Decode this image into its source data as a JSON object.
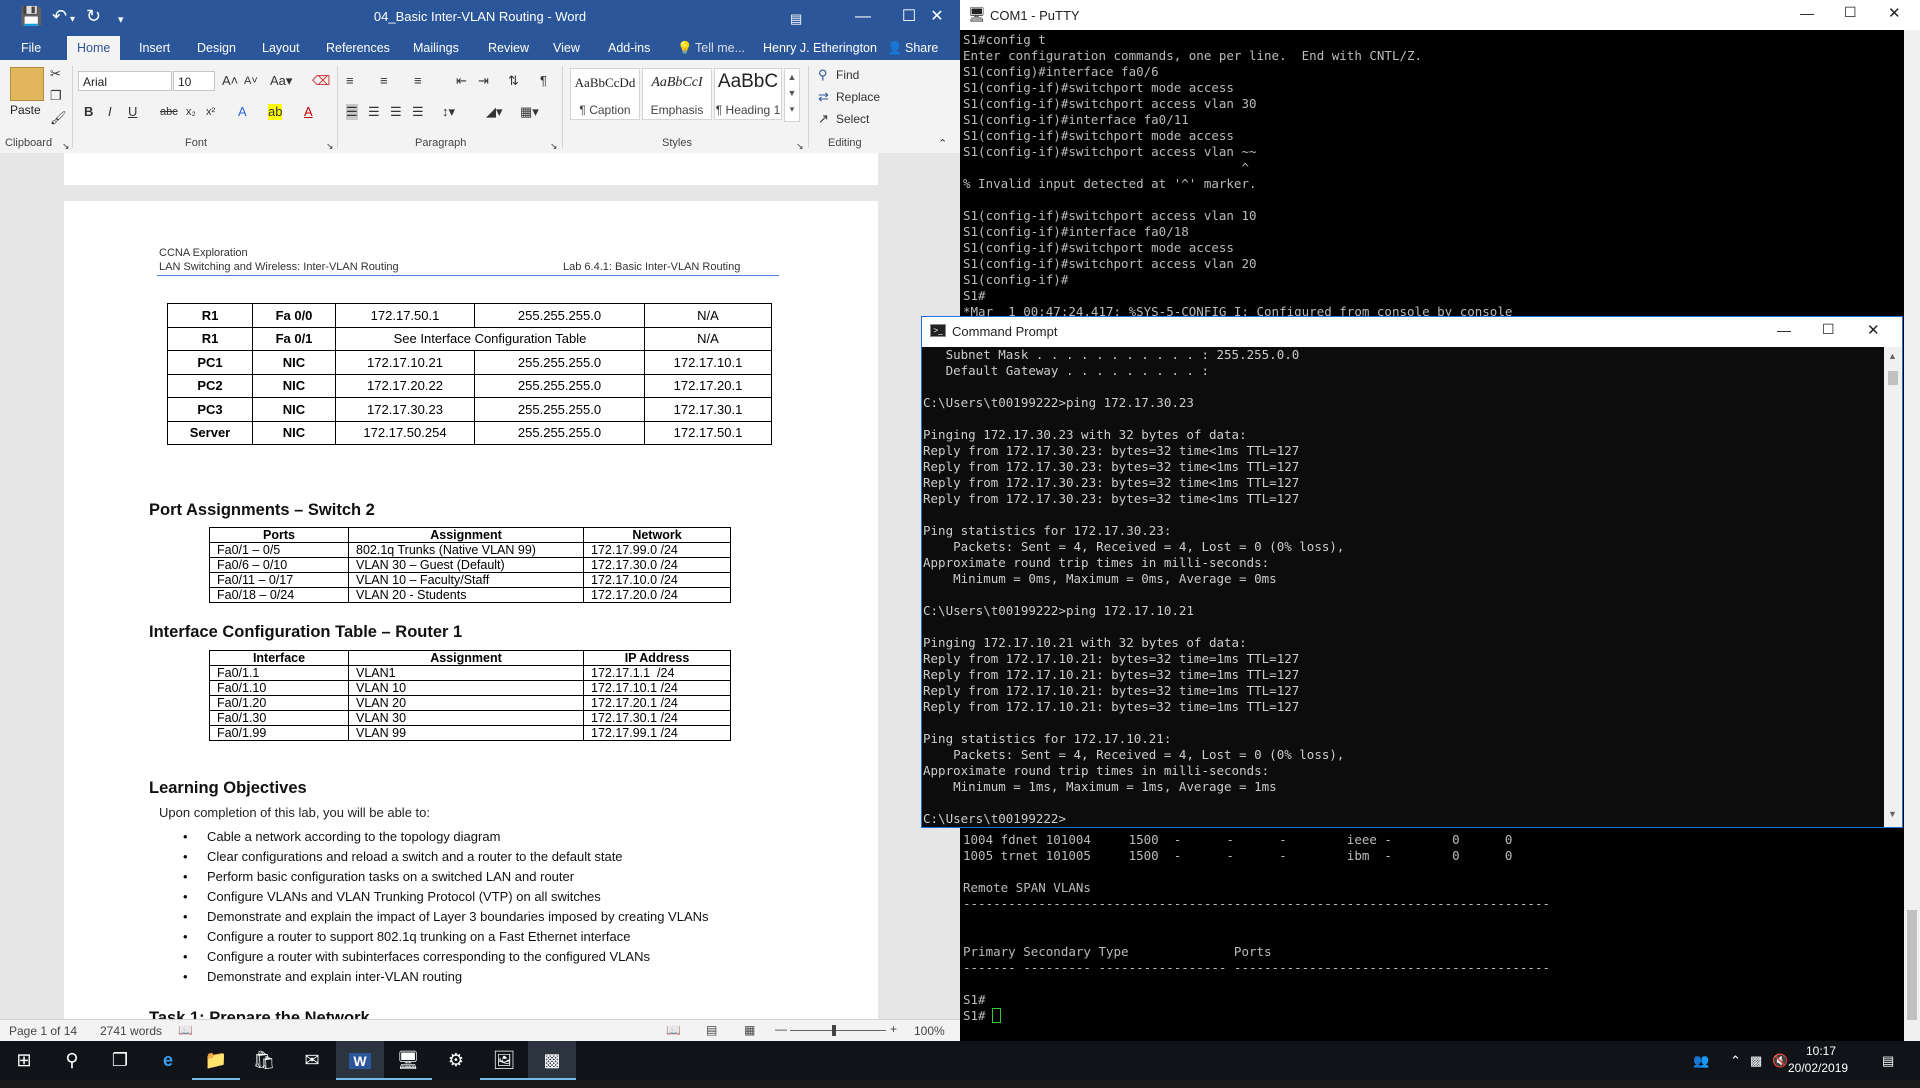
{
  "word": {
    "title": "04_Basic Inter-VLAN Routing - Word",
    "qat": {
      "save_icon": "save-icon",
      "undo_icon": "undo-icon",
      "redo_icon": "redo-icon"
    },
    "tabs": [
      "File",
      "Home",
      "Insert",
      "Design",
      "Layout",
      "References",
      "Mailings",
      "Review",
      "View",
      "Add-ins"
    ],
    "active_tab": "Home",
    "tell_me": "Tell me...",
    "user": "Henry J. Etherington",
    "share": "Share",
    "ribbon": {
      "paste": "Paste",
      "clipboard": "Clipboard",
      "font_name": "Arial",
      "font_size": "10",
      "font": "Font",
      "paragraph": "Paragraph",
      "styles": "Styles",
      "editing": "Editing",
      "style_gallery": [
        {
          "sample": "AaBbCcDd",
          "name": "¶ Caption"
        },
        {
          "sample": "AaBbCcI",
          "name": "Emphasis"
        },
        {
          "sample": "AaBbC",
          "name": "¶ Heading 1"
        }
      ],
      "find": "Find",
      "replace": "Replace",
      "select": "Select"
    },
    "doc": {
      "header_line1": "CCNA Exploration",
      "header_line2": "LAN Switching and Wireless: Inter-VLAN Routing",
      "header_right": "Lab 6.4.1: Basic Inter-VLAN Routing",
      "addr_table": [
        [
          "R1",
          "Fa 0/0",
          "172.17.50.1",
          "255.255.255.0",
          "N/A"
        ],
        [
          "R1",
          "Fa 0/1",
          "See Interface Configuration Table",
          "",
          "N/A"
        ],
        [
          "PC1",
          "NIC",
          "172.17.10.21",
          "255.255.255.0",
          "172.17.10.1"
        ],
        [
          "PC2",
          "NIC",
          "172.17.20.22",
          "255.255.255.0",
          "172.17.20.1"
        ],
        [
          "PC3",
          "NIC",
          "172.17.30.23",
          "255.255.255.0",
          "172.17.30.1"
        ],
        [
          "Server",
          "NIC",
          "172.17.50.254",
          "255.255.255.0",
          "172.17.50.1"
        ]
      ],
      "port_heading": "Port Assignments – Switch 2",
      "port_cols": [
        "Ports",
        "Assignment",
        "Network"
      ],
      "port_rows": [
        [
          "Fa0/1 – 0/5",
          "802.1q Trunks (Native VLAN 99)",
          "172.17.99.0 /24"
        ],
        [
          "Fa0/6 – 0/10",
          "VLAN 30 – Guest (Default)",
          "172.17.30.0 /24"
        ],
        [
          "Fa0/11 – 0/17",
          "VLAN 10 – Faculty/Staff",
          "172.17.10.0 /24"
        ],
        [
          "Fa0/18 – 0/24",
          "VLAN 20 - Students",
          "172.17.20.0 /24"
        ]
      ],
      "iface_heading": "Interface Configuration Table – Router 1",
      "iface_cols": [
        "Interface",
        "Assignment",
        "IP Address"
      ],
      "iface_rows": [
        [
          "Fa0/1.1",
          "VLAN1",
          "172.17.1.1  /24"
        ],
        [
          "Fa0/1.10",
          "VLAN 10",
          "172.17.10.1 /24"
        ],
        [
          "Fa0/1.20",
          "VLAN 20",
          "172.17.20.1 /24"
        ],
        [
          "Fa0/1.30",
          "VLAN 30",
          "172.17.30.1 /24"
        ],
        [
          "Fa0/1.99",
          "VLAN 99",
          "172.17.99.1 /24"
        ]
      ],
      "objectives_heading": "Learning Objectives",
      "objectives_intro": "Upon completion of this lab, you will be able to:",
      "objectives": [
        "Cable a network according to the topology diagram",
        "Clear configurations and reload a switch and a router to the default state",
        "Perform basic configuration tasks on a switched LAN and router",
        "Configure VLANs and VLAN Trunking Protocol (VTP) on all switches",
        "Demonstrate and explain the impact of Layer 3 boundaries imposed by creating VLANs",
        "Configure a router to support 802.1q trunking on a Fast Ethernet interface",
        "Configure a router with subinterfaces corresponding to the configured VLANs",
        "Demonstrate and explain inter-VLAN routing"
      ],
      "next_heading": "Task 1: Prepare the Network"
    },
    "status": {
      "page": "Page 1 of 14",
      "words": "2741 words",
      "zoom": "100%"
    }
  },
  "putty": {
    "title": "COM1 - PuTTY",
    "top_lines": [
      "S1#config t",
      "Enter configuration commands, one per line.  End with CNTL/Z.",
      "S1(config)#interface fa0/6",
      "S1(config-if)#switchport mode access",
      "S1(config-if)#switchport access vlan 30",
      "S1(config-if)#interface fa0/11",
      "S1(config-if)#switchport mode access",
      "S1(config-if)#switchport access vlan ~~",
      "                                     ^",
      "% Invalid input detected at '^' marker.",
      "",
      "S1(config-if)#switchport access vlan 10",
      "S1(config-if)#interface fa0/18",
      "S1(config-if)#switchport mode access",
      "S1(config-if)#switchport access vlan 20",
      "S1(config-if)#",
      "S1#",
      "*Mar  1 00:47:24.417: %SYS-5-CONFIG_I: Configured from console by console"
    ],
    "bottom_lines": [
      "1004 fdnet 101004     1500  -      -      -        ieee -        0      0",
      "1005 trnet 101005     1500  -      -      -        ibm  -        0      0",
      "",
      "Remote SPAN VLANs",
      "------------------------------------------------------------------------------",
      "",
      "",
      "Primary Secondary Type              Ports",
      "------- --------- ----------------- ------------------------------------------",
      "",
      "S1#",
      "S1#"
    ]
  },
  "cmd": {
    "title": "Command Prompt",
    "lines": [
      "   Subnet Mask . . . . . . . . . . . : 255.255.0.0",
      "   Default Gateway . . . . . . . . . :",
      "",
      "C:\\Users\\t00199222>ping 172.17.30.23",
      "",
      "Pinging 172.17.30.23 with 32 bytes of data:",
      "Reply from 172.17.30.23: bytes=32 time<1ms TTL=127",
      "Reply from 172.17.30.23: bytes=32 time<1ms TTL=127",
      "Reply from 172.17.30.23: bytes=32 time<1ms TTL=127",
      "Reply from 172.17.30.23: bytes=32 time<1ms TTL=127",
      "",
      "Ping statistics for 172.17.30.23:",
      "    Packets: Sent = 4, Received = 4, Lost = 0 (0% loss),",
      "Approximate round trip times in milli-seconds:",
      "    Minimum = 0ms, Maximum = 0ms, Average = 0ms",
      "",
      "C:\\Users\\t00199222>ping 172.17.10.21",
      "",
      "Pinging 172.17.10.21 with 32 bytes of data:",
      "Reply from 172.17.10.21: bytes=32 time=1ms TTL=127",
      "Reply from 172.17.10.21: bytes=32 time=1ms TTL=127",
      "Reply from 172.17.10.21: bytes=32 time=1ms TTL=127",
      "Reply from 172.17.10.21: bytes=32 time=1ms TTL=127",
      "",
      "Ping statistics for 172.17.10.21:",
      "    Packets: Sent = 4, Received = 4, Lost = 0 (0% loss),",
      "Approximate round trip times in milli-seconds:",
      "    Minimum = 1ms, Maximum = 1ms, Average = 1ms",
      "",
      "C:\\Users\\t00199222>"
    ]
  },
  "taskbar": {
    "time": "10:17",
    "date": "20/02/2019"
  }
}
